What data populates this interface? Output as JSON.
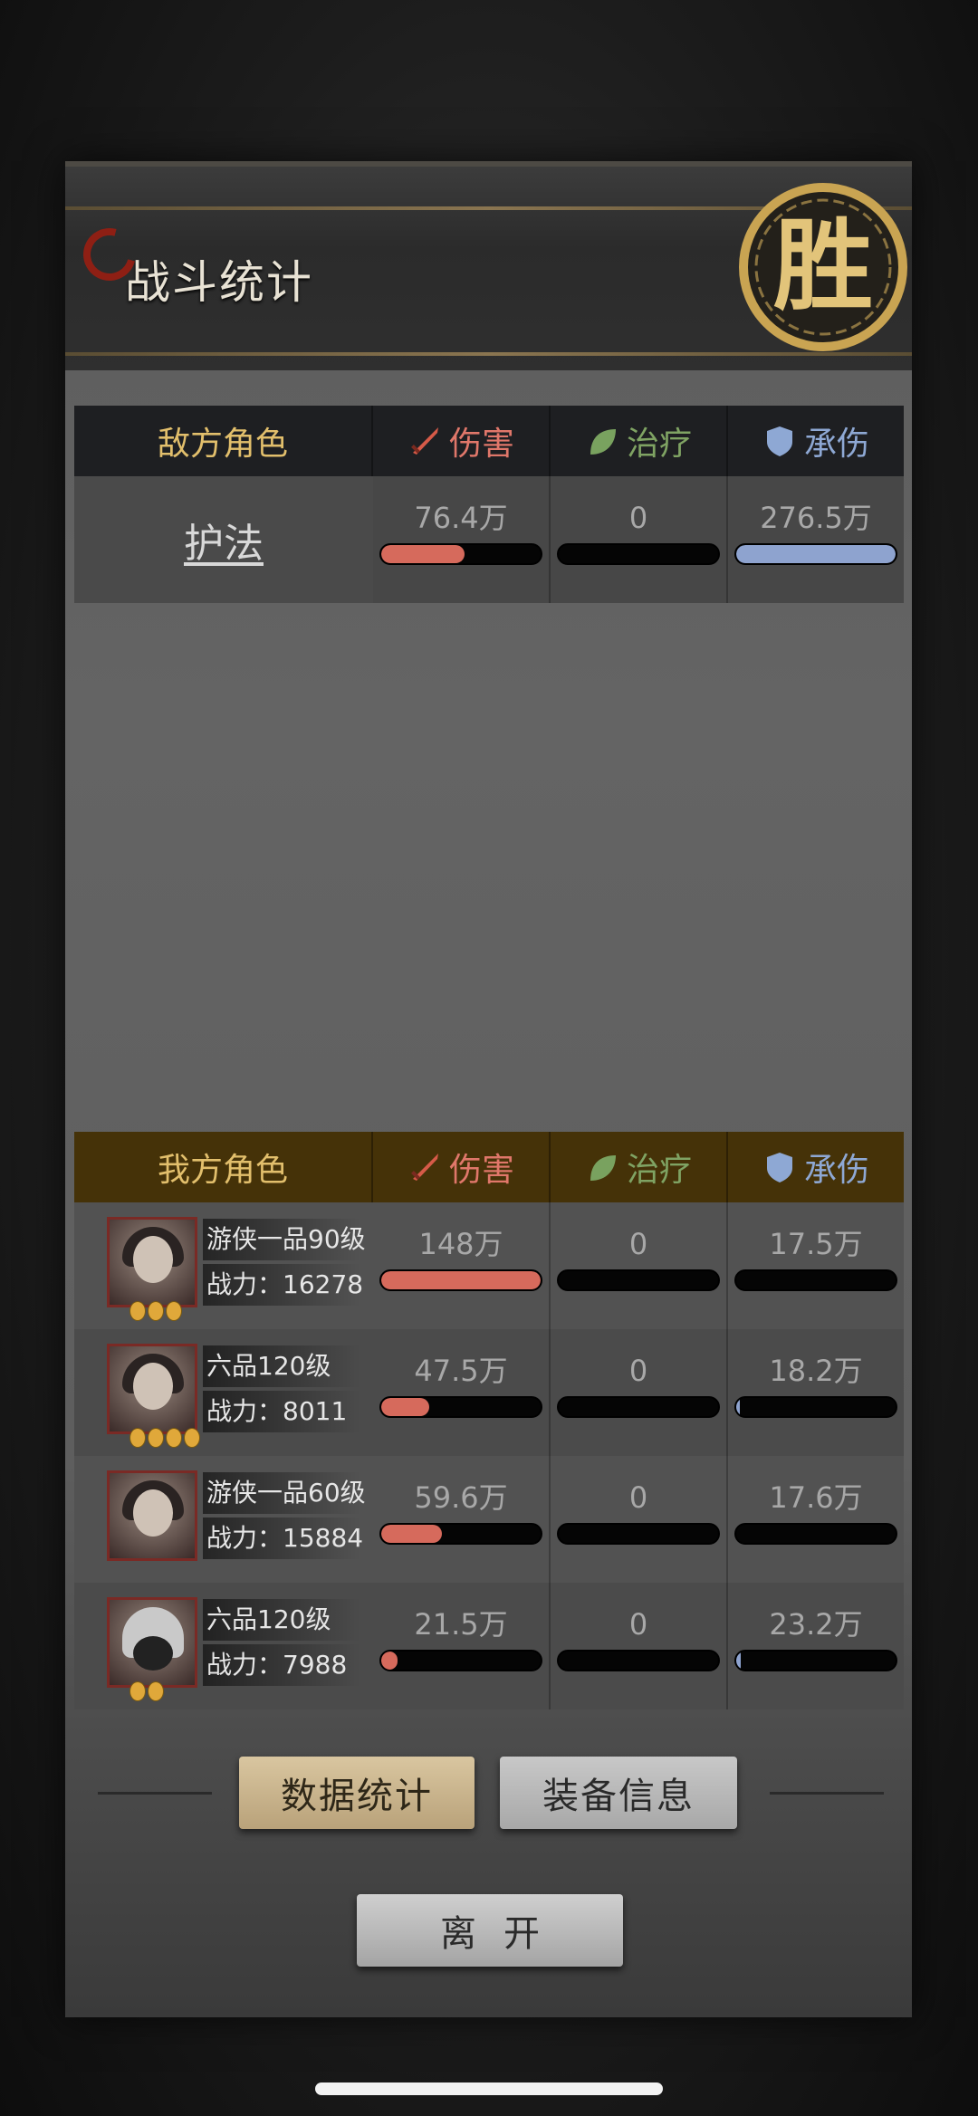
{
  "title": "战斗统计",
  "stamp_text": "胜",
  "columns": {
    "damage": "伤害",
    "heal": "治疗",
    "tank": "承伤"
  },
  "enemy": {
    "header": "敌方角色",
    "rows": [
      {
        "name": "护法",
        "damage": "76.4万",
        "heal": "0",
        "tank": "276.5万",
        "damage_frac": 0.52,
        "heal_frac": 0,
        "tank_frac": 1.0
      }
    ]
  },
  "ally": {
    "header": "我方角色",
    "rows": [
      {
        "rank": "游侠一品90级",
        "power": "战力：16278",
        "stars": 3,
        "damage": "148万",
        "heal": "0",
        "tank": "17.5万",
        "damage_frac": 1.0,
        "heal_frac": 0,
        "tank_frac": 0.0
      },
      {
        "rank": "六品120级",
        "power": "战力：8011",
        "stars": 4,
        "damage": "47.5万",
        "heal": "0",
        "tank": "18.2万",
        "damage_frac": 0.3,
        "heal_frac": 0,
        "tank_frac": 0.02
      },
      {
        "rank": "游侠一品60级",
        "power": "战力：15884",
        "stars": 0,
        "damage": "59.6万",
        "heal": "0",
        "tank": "17.6万",
        "damage_frac": 0.38,
        "heal_frac": 0,
        "tank_frac": 0.0
      },
      {
        "rank": "六品120级",
        "power": "战力：7988",
        "stars": 2,
        "damage": "21.5万",
        "heal": "0",
        "tank": "23.2万",
        "damage_frac": 0.1,
        "heal_frac": 0,
        "tank_frac": 0.03
      }
    ]
  },
  "buttons": {
    "stats": "数据统计",
    "equip": "装备信息",
    "leave": "离开"
  },
  "colors": {
    "damage": "#d66a5c",
    "heal": "#79a25f",
    "tank": "#8ea3cf",
    "gold": "#e2bf6c"
  }
}
